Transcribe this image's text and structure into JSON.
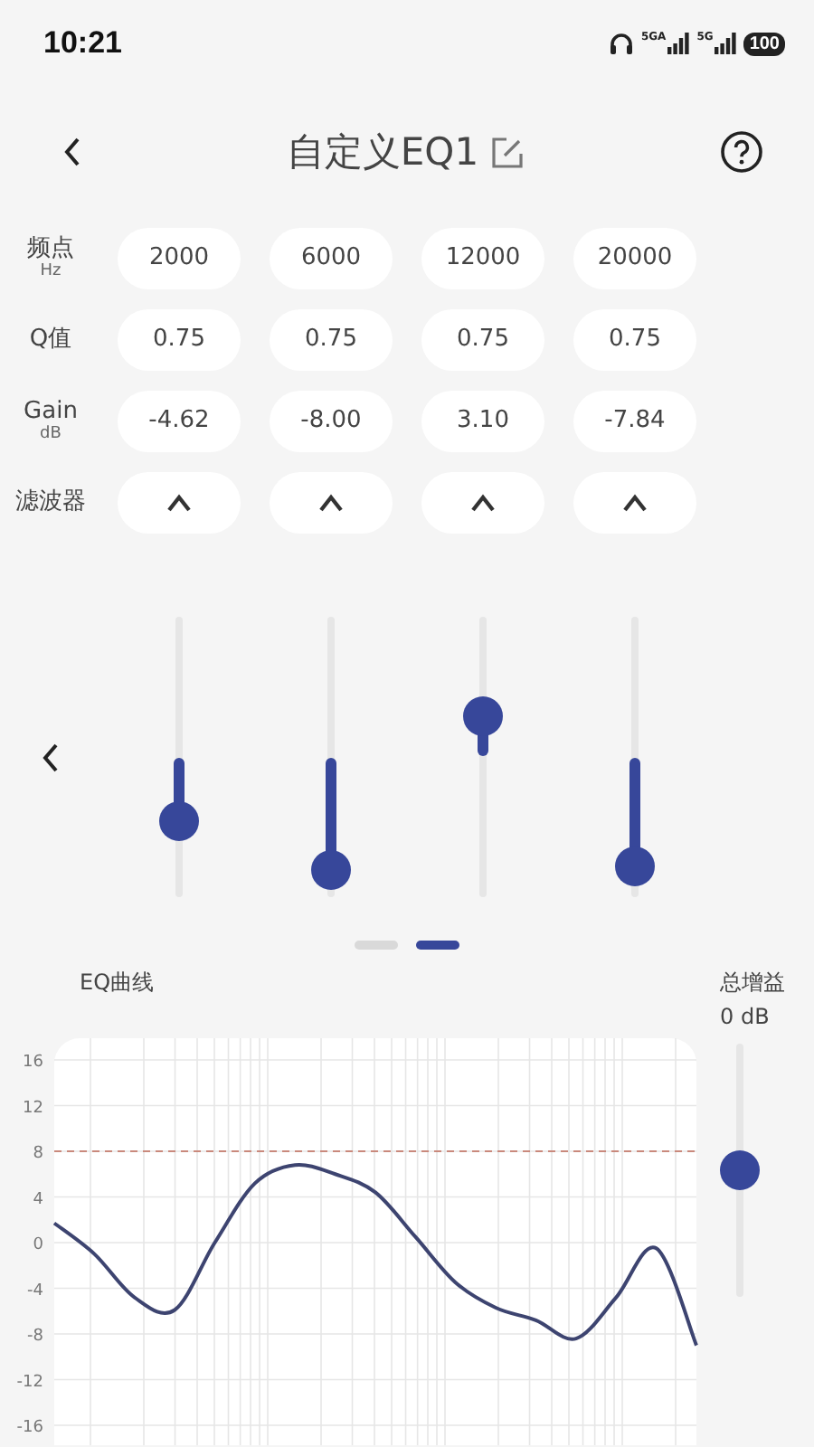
{
  "status_bar": {
    "time": "10:21",
    "network_1": "5GA",
    "network_2": "5G",
    "battery": "100"
  },
  "header": {
    "title": "自定义EQ1"
  },
  "params": [
    {
      "kind": "frequency",
      "label": "频点",
      "unit": "Hz"
    },
    {
      "kind": "q",
      "label": "Q值"
    },
    {
      "kind": "gain",
      "label": "Gain",
      "unit": "dB"
    },
    {
      "kind": "filter",
      "label": "滤波器"
    }
  ],
  "bands": [
    {
      "frequency": "2000",
      "q": "0.75",
      "gain": "-4.62",
      "kind": "peak",
      "level": 0.27
    },
    {
      "frequency": "6000",
      "q": "0.75",
      "gain": "-8.00",
      "kind": "peak",
      "level": 0.1
    },
    {
      "frequency": "12000",
      "q": "0.75",
      "gain": "3.10",
      "kind": "peak",
      "level": 0.645
    },
    {
      "frequency": "20000",
      "q": "0.75",
      "gain": "-7.84",
      "kind": "peak",
      "level": 0.11
    }
  ],
  "pages": [
    {
      "selected": false
    },
    {
      "selected": true
    }
  ],
  "curve": {
    "chart_data": {
      "type": "line",
      "title": "EQ曲线",
      "series": [
        {
          "color": "#3d4470",
          "values": [
            1.7,
            -1.0,
            -4.8,
            -5.9,
            0,
            5.2,
            6.8,
            6.0,
            4.4,
            0.5,
            -3.5,
            -5.7,
            -6.8,
            -8.4,
            -4.8,
            -0.5,
            -9.0
          ]
        }
      ],
      "ylim": [
        -16,
        16
      ],
      "yticks": [
        16,
        12,
        8,
        4,
        0,
        -4,
        -8,
        -12,
        -16
      ],
      "grid": true,
      "ref_lines": [
        {
          "axis": "y",
          "value": 8,
          "color": "#c9897c"
        }
      ]
    }
  },
  "total_gain": {
    "label": "总增益",
    "value": "0 dB",
    "level": 0.5
  }
}
